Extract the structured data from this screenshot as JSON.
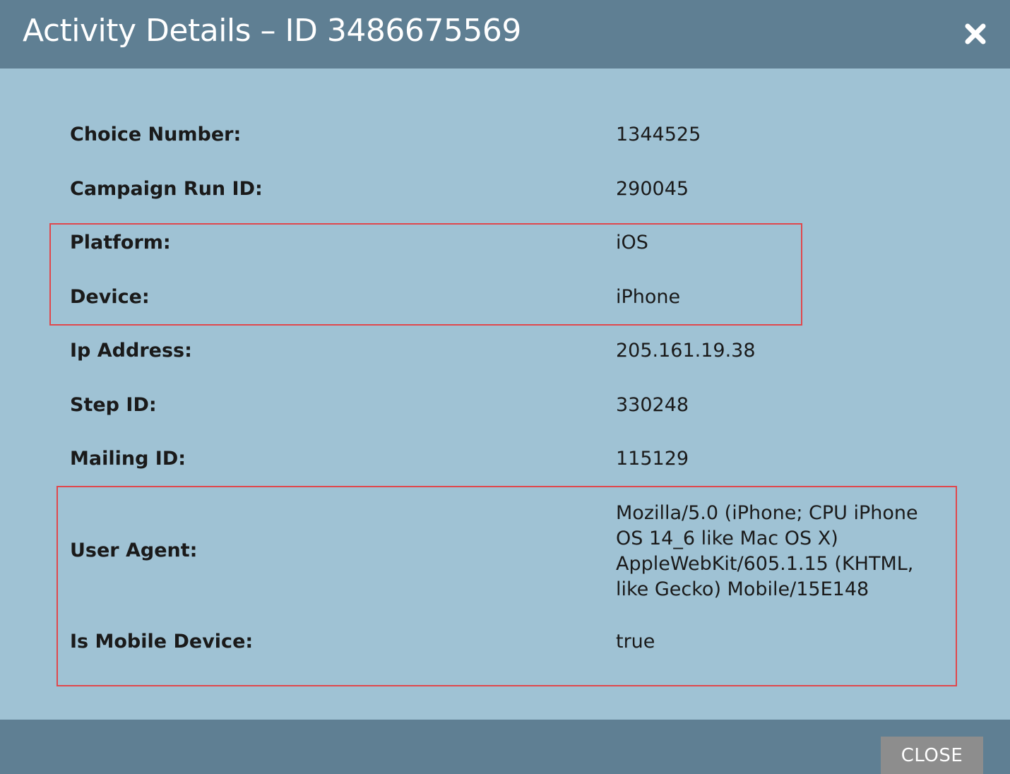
{
  "dialog": {
    "title": "Activity Details – ID 3486675569",
    "close_icon": "close-icon",
    "close_button_label": "CLOSE"
  },
  "fields": [
    {
      "label": "Choice Number:",
      "value": "1344525"
    },
    {
      "label": "Campaign Run ID:",
      "value": "290045"
    },
    {
      "label": "Platform:",
      "value": "iOS"
    },
    {
      "label": "Device:",
      "value": "iPhone"
    },
    {
      "label": "Ip Address:",
      "value": "205.161.19.38"
    },
    {
      "label": "Step ID:",
      "value": "330248"
    },
    {
      "label": "Mailing ID:",
      "value": "115129"
    },
    {
      "label": "User Agent:",
      "value": "Mozilla/5.0 (iPhone; CPU iPhone OS 14_6 like Mac OS X) AppleWebKit/605.1.15 (KHTML, like Gecko) Mobile/15E148"
    },
    {
      "label": "Is Mobile Device:",
      "value": "true"
    }
  ],
  "colors": {
    "header_bg": "#5f7f93",
    "body_bg": "#9fc2d4",
    "highlight_border": "#e0474c",
    "button_bg": "#8d8d8d"
  }
}
